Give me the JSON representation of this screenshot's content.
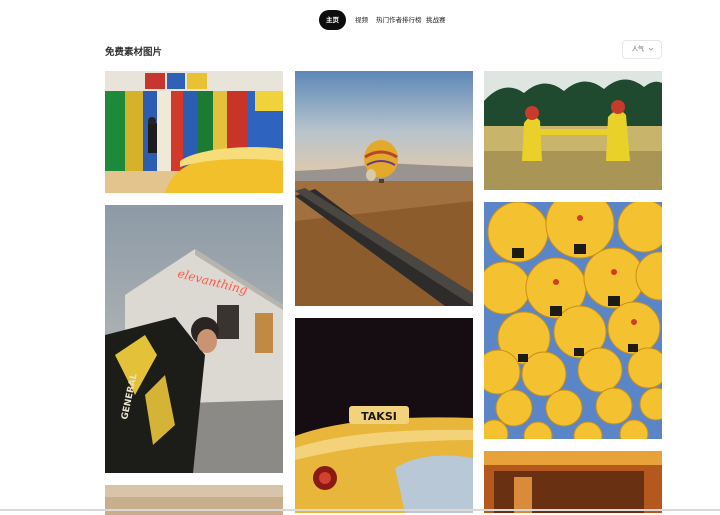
{
  "nav": {
    "tabs": [
      {
        "label": "主页",
        "active": true
      },
      {
        "label": "视频",
        "active": false
      },
      {
        "label": "热门作者排行榜",
        "active": false
      },
      {
        "label": "挑战赛",
        "active": false
      }
    ]
  },
  "gallery": {
    "title": "免费素材图片",
    "sort_value": "人气"
  },
  "cards": {
    "taxi_sign_text": "TAKSI",
    "neon_sign_text": "elevanthing"
  },
  "colors": {
    "nav_active_bg": "#0d0d0d",
    "accent_yellow": "#f2c230"
  }
}
